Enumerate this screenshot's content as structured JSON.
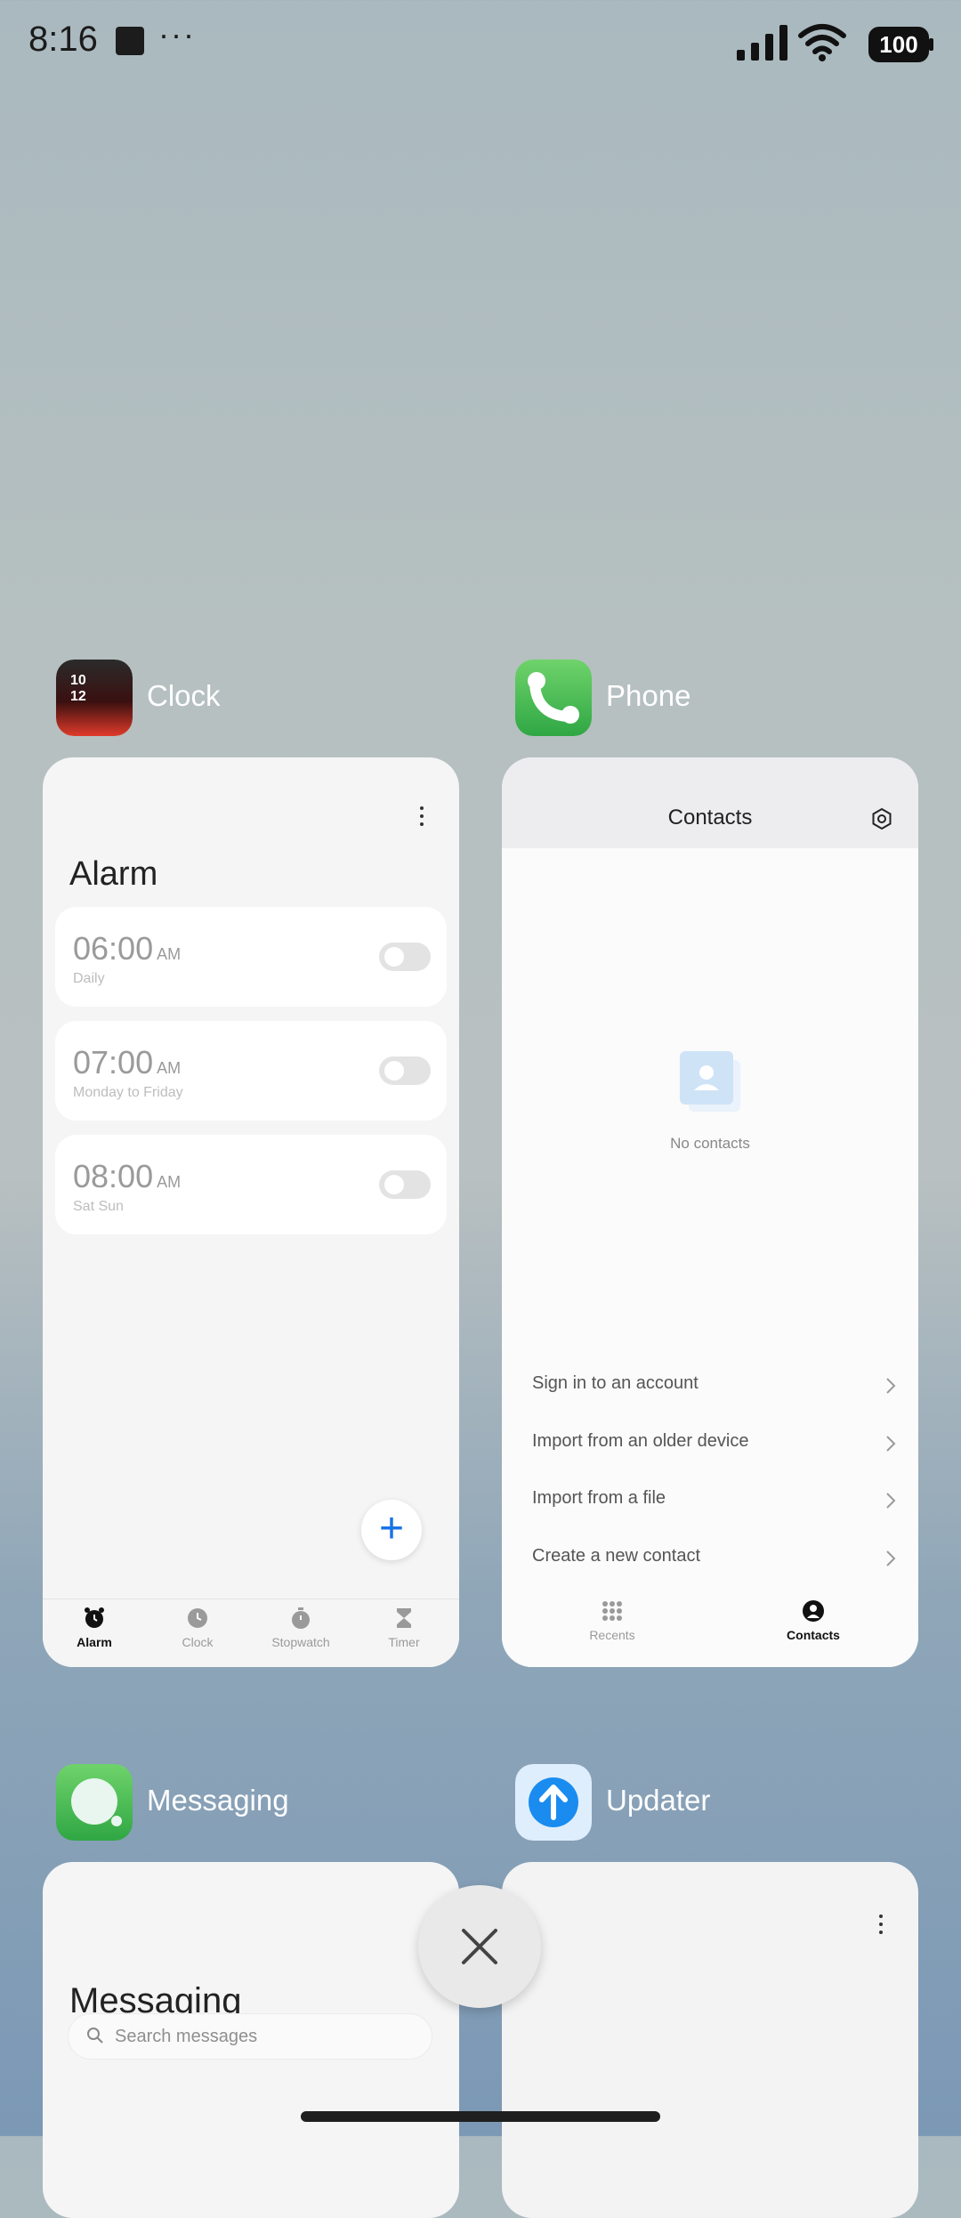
{
  "status_bar": {
    "time": "8:16",
    "overflow": "···",
    "battery": "100"
  },
  "apps": {
    "clock": {
      "name": "Clock",
      "alarm_title": "Alarm",
      "alarms": [
        {
          "time": "06:00",
          "ampm": "AM",
          "repeat": "Daily",
          "enabled": false
        },
        {
          "time": "07:00",
          "ampm": "AM",
          "repeat": "Monday to Friday",
          "enabled": false
        },
        {
          "time": "08:00",
          "ampm": "AM",
          "repeat": "Sat Sun",
          "enabled": false
        }
      ],
      "nav": [
        "Alarm",
        "Clock",
        "Stopwatch",
        "Timer"
      ]
    },
    "phone": {
      "name": "Phone",
      "title": "Contacts",
      "empty_text": "No contacts",
      "actions": [
        "Sign in to an account",
        "Import from an older device",
        "Import from a file",
        "Create a new contact"
      ],
      "nav": [
        "Recents",
        "Contacts"
      ]
    },
    "messaging": {
      "name": "Messaging",
      "title": "Messaging",
      "search_placeholder": "Search messages"
    },
    "updater": {
      "name": "Updater"
    }
  },
  "colors": {
    "accent": "#1a73e8"
  }
}
